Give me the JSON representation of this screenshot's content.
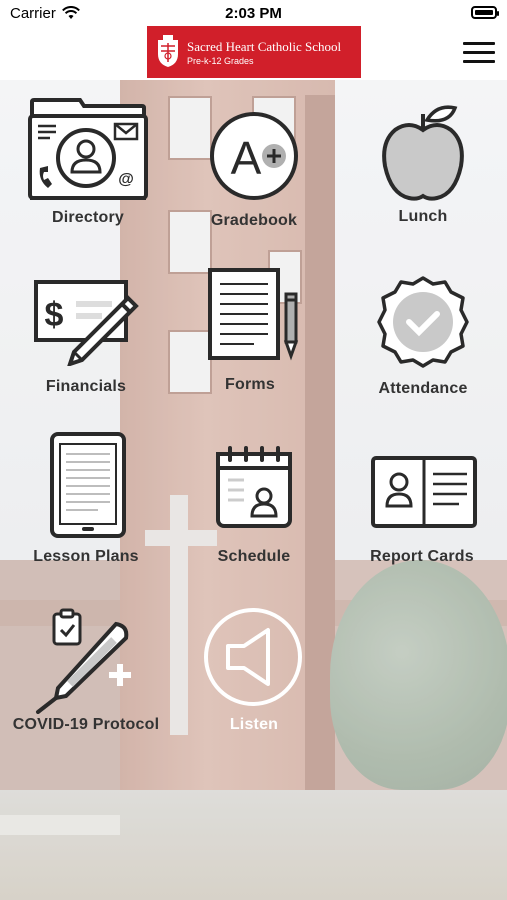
{
  "status_bar": {
    "carrier": "Carrier",
    "time": "2:03 PM"
  },
  "header": {
    "school_name": "Sacred Heart Catholic School",
    "grades": "Pre-k-12 Grades",
    "brand_color": "#d11f2a"
  },
  "tiles": [
    {
      "label": "Directory",
      "icon": "directory-icon"
    },
    {
      "label": "Gradebook",
      "icon": "gradebook-icon"
    },
    {
      "label": "Lunch",
      "icon": "apple-icon"
    },
    {
      "label": "Financials",
      "icon": "check-pen-icon"
    },
    {
      "label": "Forms",
      "icon": "document-pencil-icon"
    },
    {
      "label": "Attendance",
      "icon": "check-badge-icon"
    },
    {
      "label": "Lesson Plans",
      "icon": "tablet-icon"
    },
    {
      "label": "Schedule",
      "icon": "calendar-person-icon"
    },
    {
      "label": "Report Cards",
      "icon": "report-card-icon"
    },
    {
      "label": "COVID-19 Protocol",
      "icon": "thermometer-icon"
    },
    {
      "label": "Listen",
      "icon": "speaker-icon"
    }
  ]
}
